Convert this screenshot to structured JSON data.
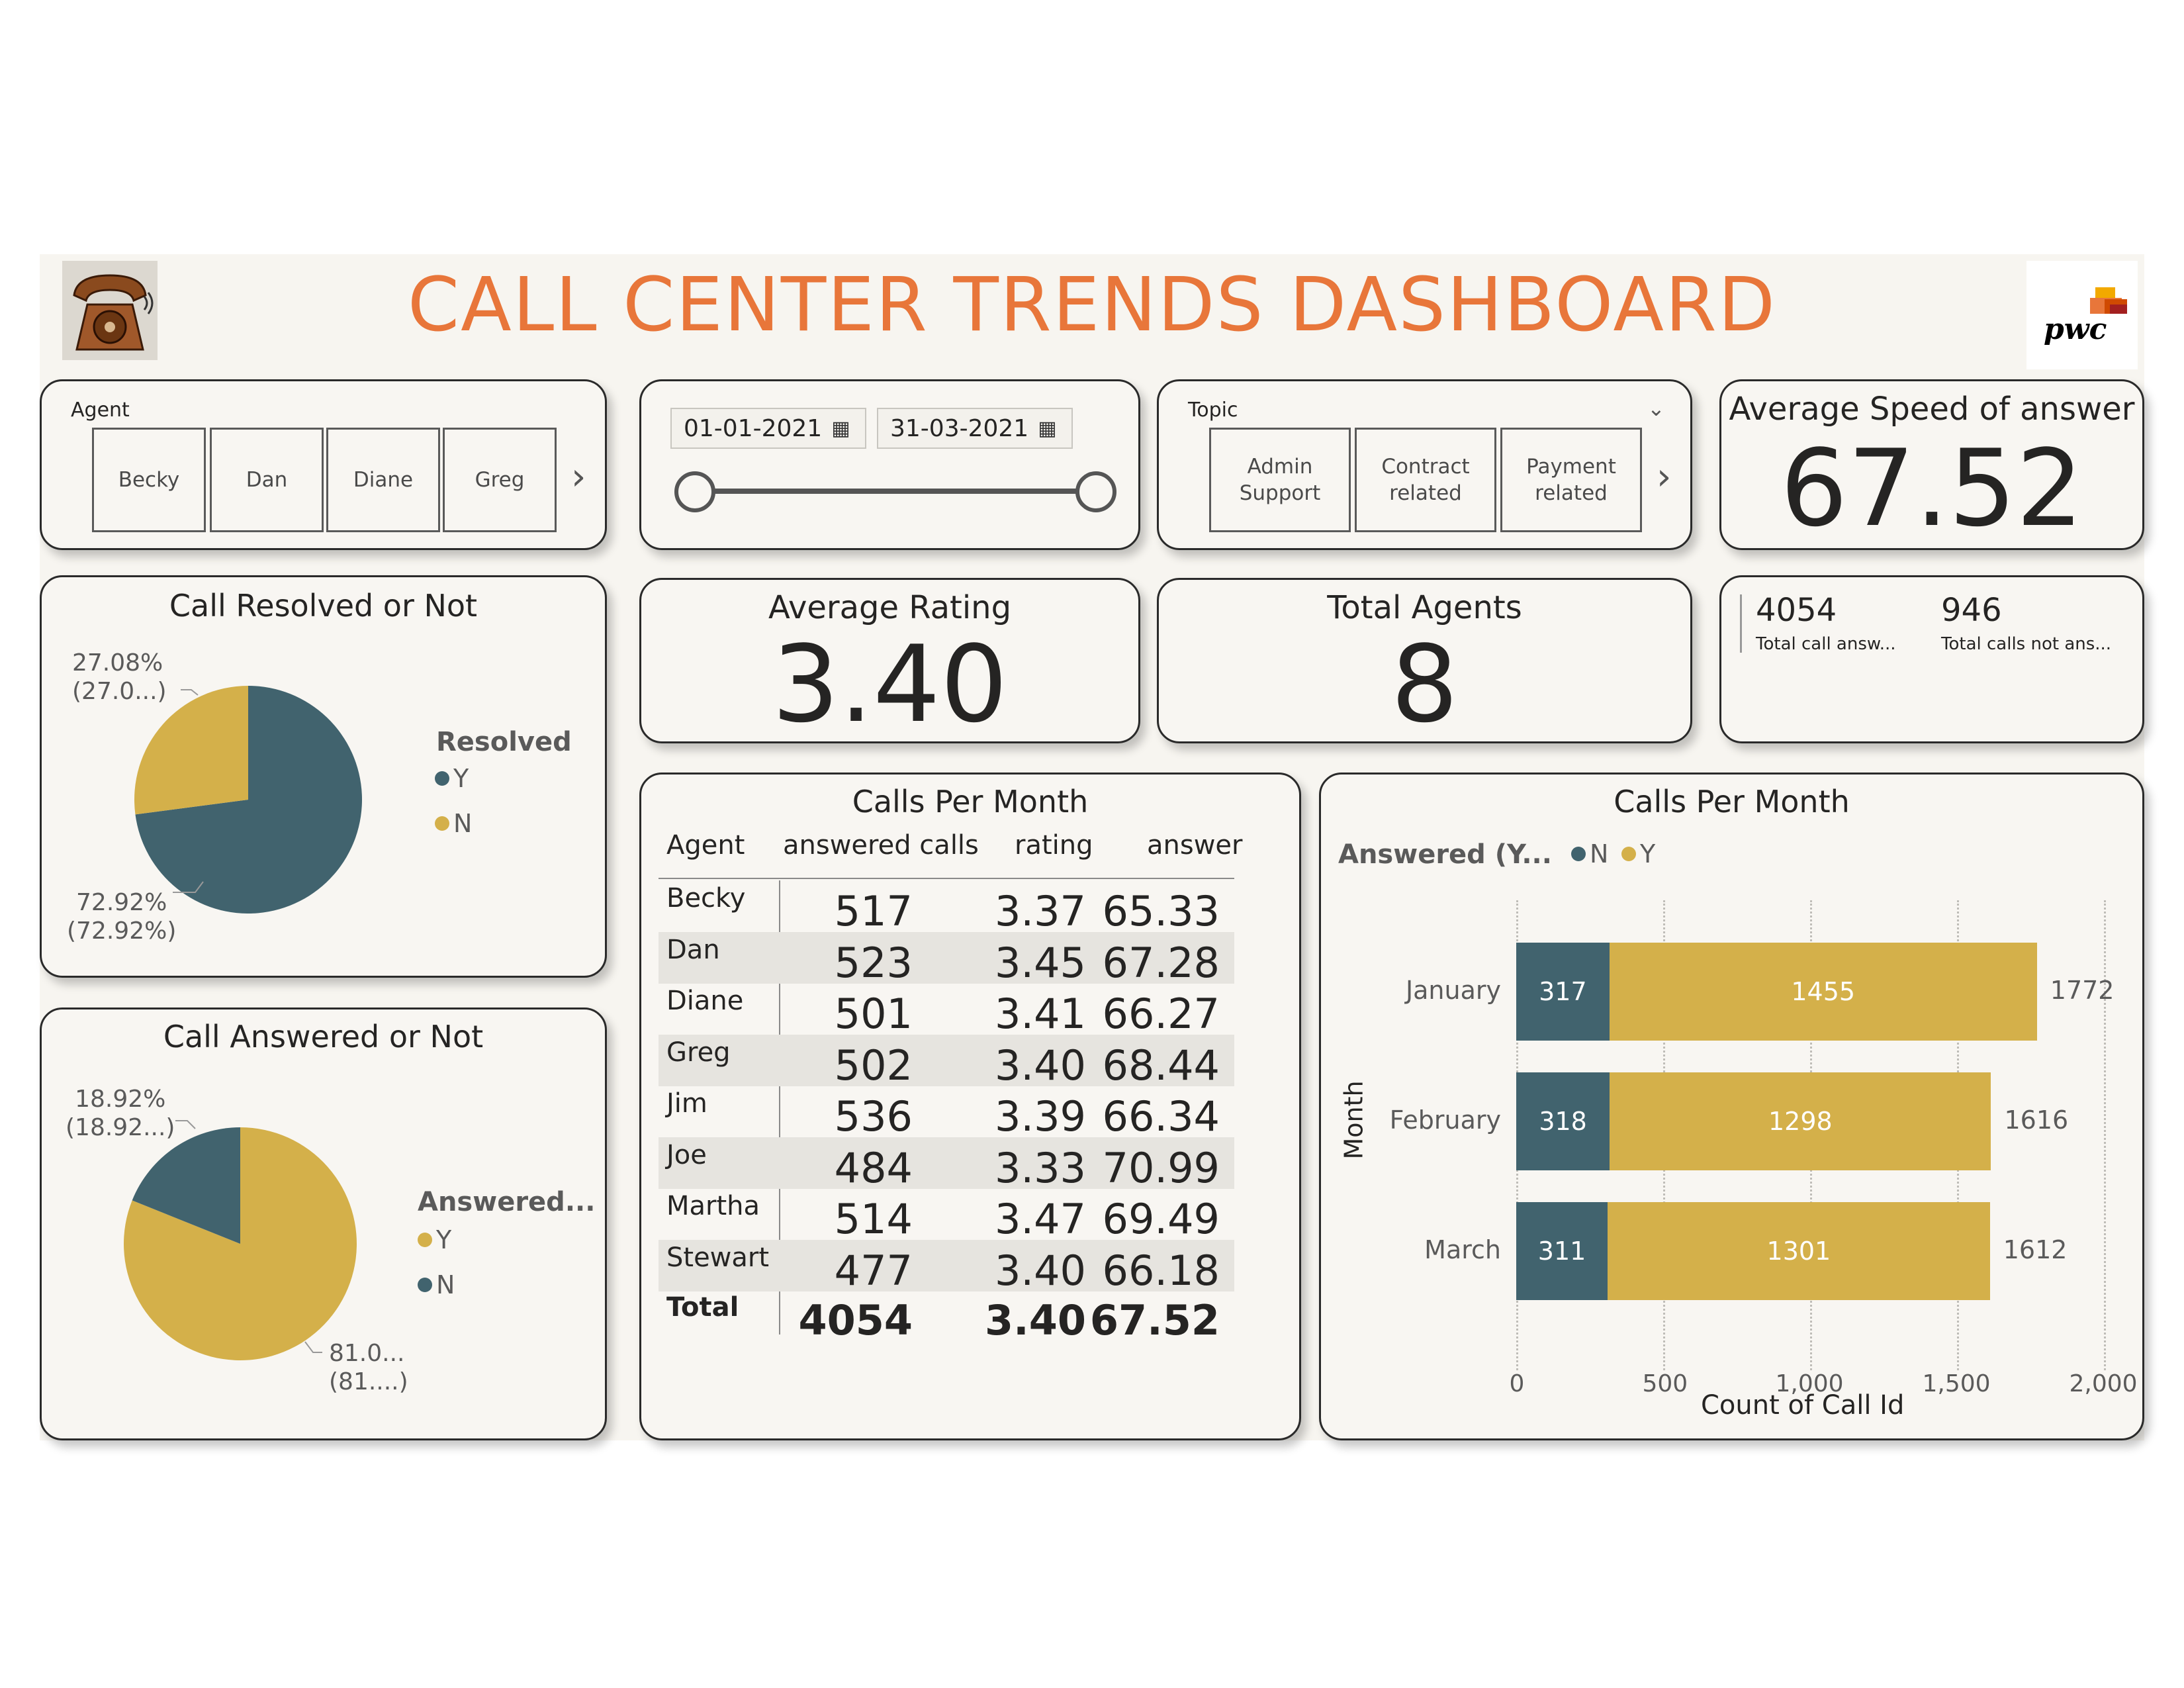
{
  "header": {
    "title": "CALL CENTER TRENDS DASHBOARD",
    "logo_icon": "telephone-icon",
    "brand_logo_text": "pwc"
  },
  "colors": {
    "accent_title": "#e8763a",
    "series_n": "#41636e",
    "series_y": "#d4b04a"
  },
  "agent_slicer": {
    "label": "Agent",
    "options": [
      "Becky",
      "Dan",
      "Diane",
      "Greg"
    ]
  },
  "date_slicer": {
    "start": "01-01-2021",
    "end": "31-03-2021"
  },
  "topic_slicer": {
    "label": "Topic",
    "options": [
      "Admin Support",
      "Contract related",
      "Payment related"
    ]
  },
  "kpis": {
    "avg_speed": {
      "title": "Average Speed of answer",
      "value": "67.52"
    },
    "avg_rating": {
      "title": "Average Rating",
      "value": "3.40"
    },
    "total_agents": {
      "title": "Total Agents",
      "value": "8"
    },
    "answered": {
      "value": "4054",
      "caption": "Total call answ..."
    },
    "not_answered": {
      "value": "946",
      "caption": "Total calls not ans..."
    }
  },
  "resolved_pie": {
    "title": "Call Resolved or Not",
    "legend_title": "Resolved",
    "legend": [
      "Y",
      "N"
    ],
    "label_small": [
      "27.08%",
      "(27.0...)"
    ],
    "label_large": [
      "72.92%",
      "(72.92%)"
    ]
  },
  "answered_pie": {
    "title": "Call Answered or Not",
    "legend_title": "Answered...",
    "legend": [
      "Y",
      "N"
    ],
    "label_small": [
      "18.92%",
      "(18.92...)"
    ],
    "label_large": [
      "81.0...",
      "(81....)"
    ]
  },
  "table": {
    "title": "Calls Per Month",
    "headers": [
      "Agent",
      "answered calls",
      "rating",
      "answer"
    ],
    "rows": [
      [
        "Becky",
        "517",
        "3.37",
        "65.33"
      ],
      [
        "Dan",
        "523",
        "3.45",
        "67.28"
      ],
      [
        "Diane",
        "501",
        "3.41",
        "66.27"
      ],
      [
        "Greg",
        "502",
        "3.40",
        "68.44"
      ],
      [
        "Jim",
        "536",
        "3.39",
        "66.34"
      ],
      [
        "Joe",
        "484",
        "3.33",
        "70.99"
      ],
      [
        "Martha",
        "514",
        "3.47",
        "69.49"
      ],
      [
        "Stewart",
        "477",
        "3.40",
        "66.18"
      ]
    ],
    "total": [
      "Total",
      "4054",
      "3.40",
      "67.52"
    ]
  },
  "bar_chart": {
    "title": "Calls Per Month",
    "legend_title": "Answered (Y...",
    "legend": [
      "N",
      "Y"
    ],
    "ylabel": "Month",
    "xlabel": "Count of Call Id",
    "ticks": [
      "0",
      "500",
      "1,000",
      "1,500",
      "2,000"
    ]
  },
  "chart_data": [
    {
      "type": "pie",
      "title": "Call Resolved or Not",
      "categories": [
        "Y",
        "N"
      ],
      "values": [
        72.92,
        27.08
      ]
    },
    {
      "type": "pie",
      "title": "Call Answered or Not",
      "categories": [
        "Y",
        "N"
      ],
      "values": [
        81.08,
        18.92
      ]
    },
    {
      "type": "bar",
      "orientation": "horizontal",
      "stacked": true,
      "title": "Calls Per Month",
      "categories": [
        "January",
        "February",
        "March"
      ],
      "series": [
        {
          "name": "N",
          "values": [
            317,
            318,
            311
          ]
        },
        {
          "name": "Y",
          "values": [
            1455,
            1298,
            1301
          ]
        }
      ],
      "totals": [
        1772,
        1616,
        1612
      ],
      "xlabel": "Count of Call Id",
      "ylabel": "Month",
      "xlim": [
        0,
        2000
      ],
      "grid": true,
      "legend": "top-left"
    }
  ]
}
